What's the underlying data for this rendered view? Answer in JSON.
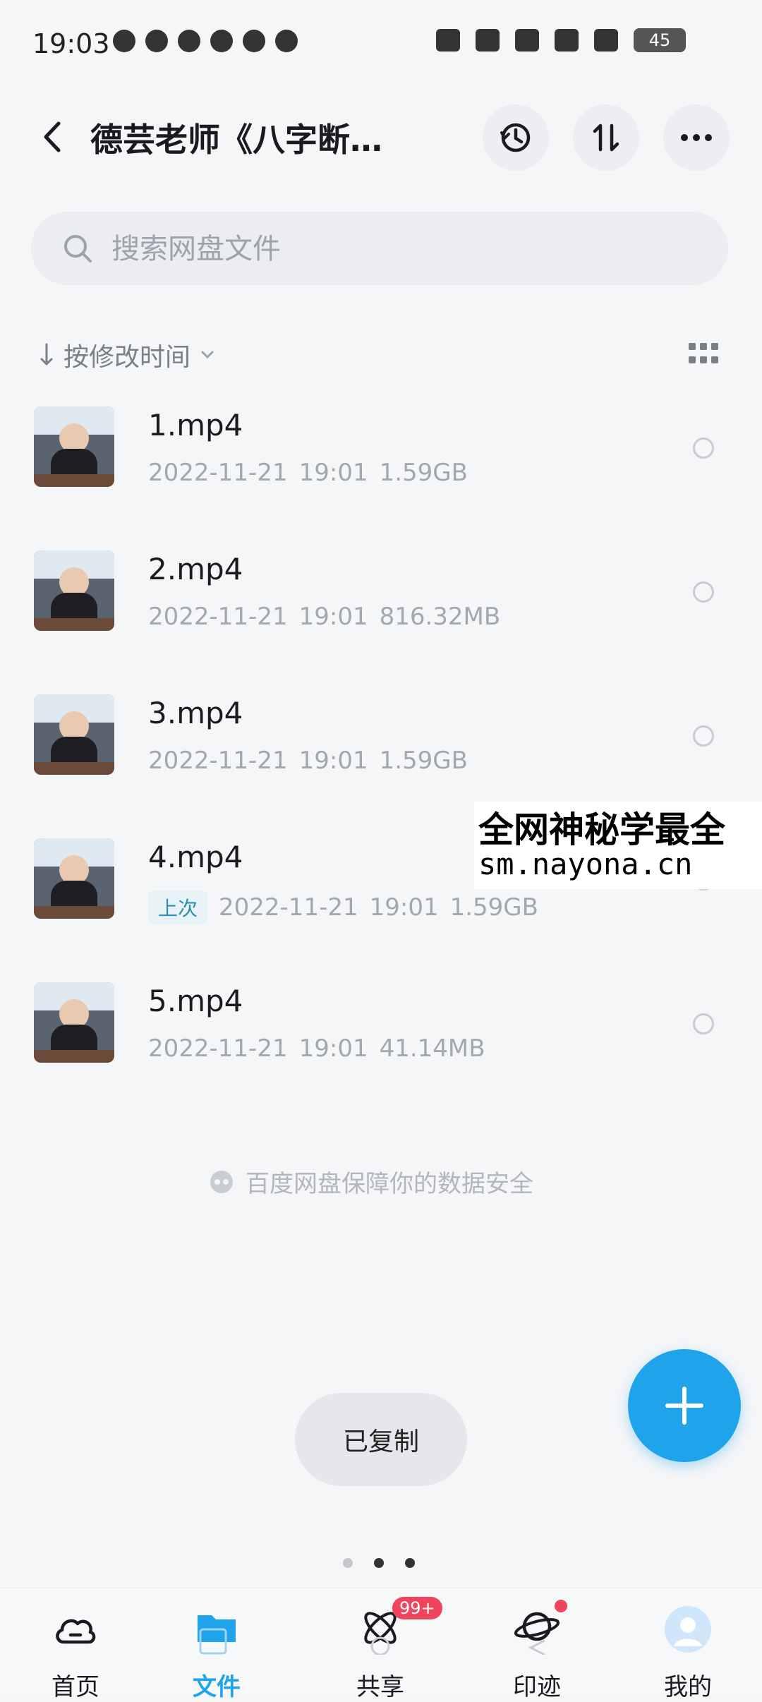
{
  "status_bar": {
    "time": "19:03",
    "battery": "45"
  },
  "header": {
    "title": "德芸老师《八字断…"
  },
  "search": {
    "placeholder": "搜索网盘文件"
  },
  "sort": {
    "label": "按修改时间"
  },
  "files": [
    {
      "name": "1.mp4",
      "date": "2022-11-21",
      "time": "19:01",
      "size": "1.59GB",
      "tag": ""
    },
    {
      "name": "2.mp4",
      "date": "2022-11-21",
      "time": "19:01",
      "size": "816.32MB",
      "tag": ""
    },
    {
      "name": "3.mp4",
      "date": "2022-11-21",
      "time": "19:01",
      "size": "1.59GB",
      "tag": ""
    },
    {
      "name": "4.mp4",
      "date": "2022-11-21",
      "time": "19:01",
      "size": "1.59GB",
      "tag": "上次"
    },
    {
      "name": "5.mp4",
      "date": "2022-11-21",
      "time": "19:01",
      "size": "41.14MB",
      "tag": ""
    }
  ],
  "watermark": {
    "line1": "全网神秘学最全",
    "line2": "sm.nayona.cn"
  },
  "safe_note": "百度网盘保障你的数据安全",
  "toast": "已复制",
  "bottom_nav": {
    "items": [
      {
        "label": "首页",
        "icon": "cloud-icon"
      },
      {
        "label": "文件",
        "icon": "folder-icon"
      },
      {
        "label": "共享",
        "icon": "atom-icon",
        "badge": "99+"
      },
      {
        "label": "印迹",
        "icon": "planet-icon"
      },
      {
        "label": "我的",
        "icon": "avatar-icon"
      }
    ]
  },
  "colors": {
    "accent": "#1fa3ea",
    "badge": "#f0435e",
    "background": "#f5f6f8"
  }
}
